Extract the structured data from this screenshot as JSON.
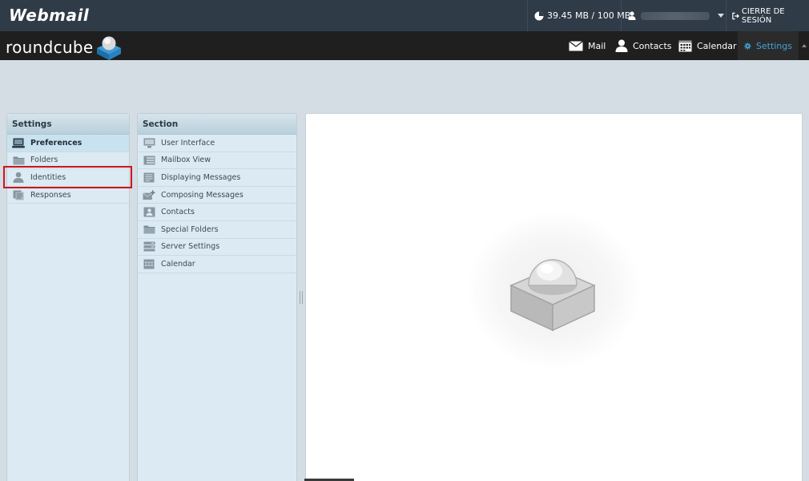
{
  "topbar": {
    "brand": "Webmail",
    "quota": "39.45 MB / 100 MB",
    "logout_label": "CIERRE DE SESIÓN"
  },
  "header": {
    "brand": "roundcube",
    "nav": [
      {
        "label": "Mail",
        "icon": "envelope-icon"
      },
      {
        "label": "Contacts",
        "icon": "person-icon"
      },
      {
        "label": "Calendar",
        "icon": "calendar-icon"
      },
      {
        "label": "Settings",
        "icon": "gear-icon",
        "active": true
      }
    ]
  },
  "settings_panel": {
    "title": "Settings",
    "items": [
      {
        "label": "Preferences",
        "icon": "monitor-icon",
        "selected": true
      },
      {
        "label": "Folders",
        "icon": "folder-icon"
      },
      {
        "label": "Identities",
        "icon": "person-icon",
        "highlighted": true
      },
      {
        "label": "Responses",
        "icon": "responses-icon"
      }
    ]
  },
  "section_panel": {
    "title": "Section",
    "items": [
      {
        "label": "User Interface",
        "icon": "monitor-icon"
      },
      {
        "label": "Mailbox View",
        "icon": "mailbox-icon"
      },
      {
        "label": "Displaying Messages",
        "icon": "message-icon"
      },
      {
        "label": "Composing Messages",
        "icon": "compose-icon"
      },
      {
        "label": "Contacts",
        "icon": "contact-card-icon"
      },
      {
        "label": "Special Folders",
        "icon": "folder-icon"
      },
      {
        "label": "Server Settings",
        "icon": "server-icon"
      },
      {
        "label": "Calendar",
        "icon": "calendar-icon"
      }
    ]
  },
  "colors": {
    "topbar": "#2f3b47",
    "header": "#1f1f1f",
    "active_nav": "#3fa3de",
    "highlight": "#d0141b",
    "panel": "#dbeaf3"
  }
}
